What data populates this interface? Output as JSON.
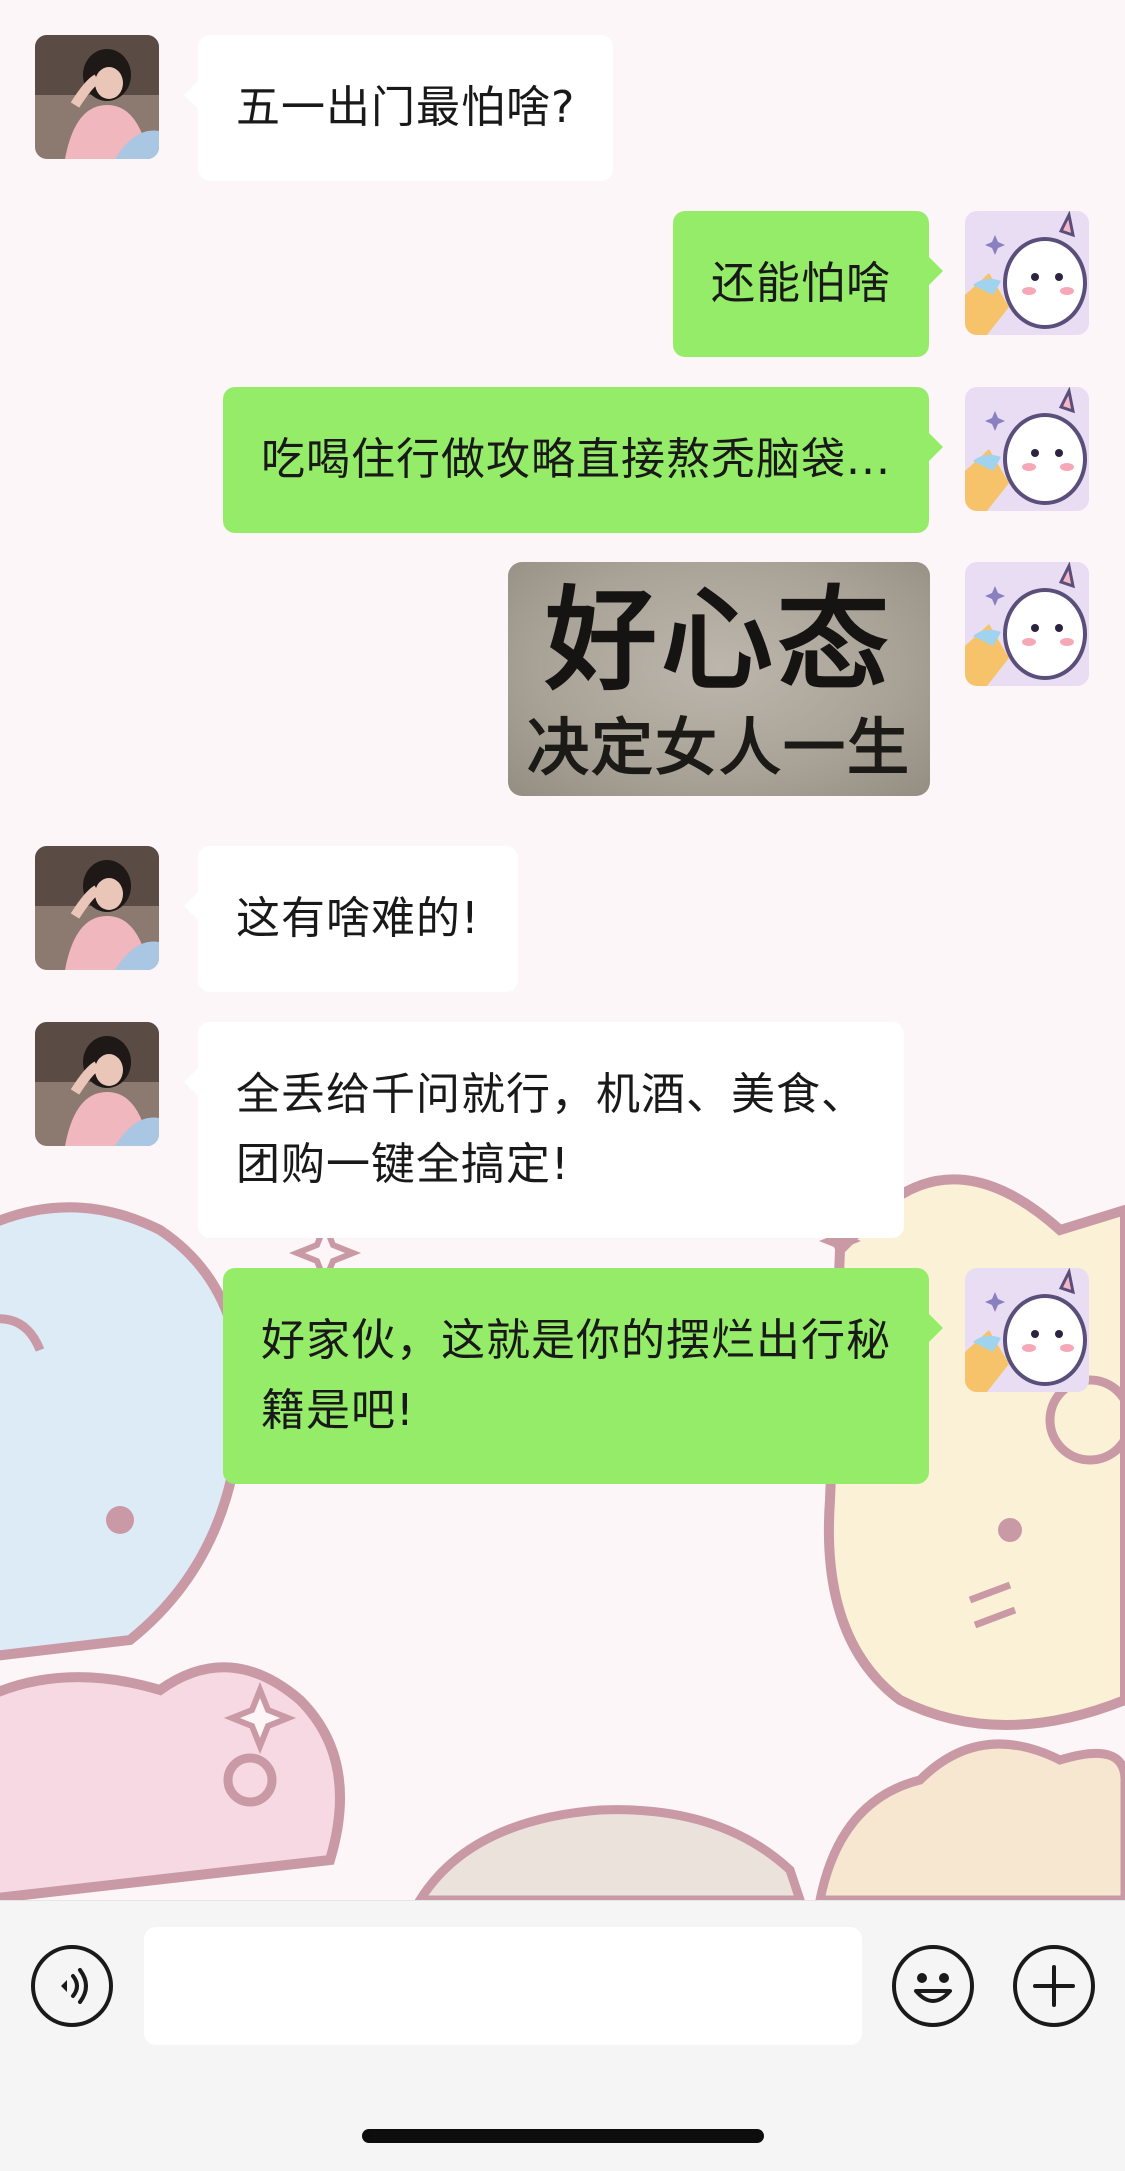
{
  "chat": {
    "messages": [
      {
        "side": "in",
        "type": "text",
        "lines": [
          "五一出门最怕啥?"
        ]
      },
      {
        "side": "out",
        "type": "text",
        "lines": [
          "还能怕啥"
        ]
      },
      {
        "side": "out",
        "type": "text",
        "lines": [
          "吃喝住行做攻略直接熬秃脑袋..."
        ]
      },
      {
        "side": "out",
        "type": "sticker",
        "lines": [
          "好心态",
          "决定女人一生"
        ]
      },
      {
        "side": "in",
        "type": "text",
        "lines": [
          "这有啥难的!"
        ]
      },
      {
        "side": "in",
        "type": "text",
        "lines": [
          "全丢给千问就行，机酒、美食、",
          "团购一键全搞定!"
        ]
      },
      {
        "side": "out",
        "type": "text",
        "lines": [
          "好家伙，这就是你的摆烂出行秘",
          "籍是吧!"
        ]
      }
    ]
  },
  "input_bar": {
    "voice_icon": "voice-icon",
    "emoji_icon": "emoji-icon",
    "plus_icon": "plus-icon",
    "input_value": ""
  },
  "colors": {
    "outgoing_bubble": "#95ec69",
    "incoming_bubble": "#ffffff",
    "input_bar_bg": "#f5f5f5"
  }
}
